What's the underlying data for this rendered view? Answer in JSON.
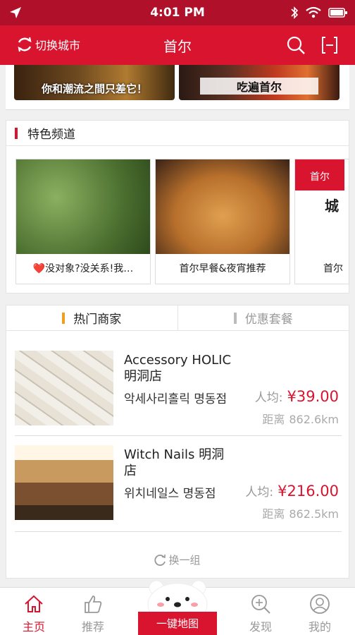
{
  "status": {
    "time": "4:01 PM",
    "icons": [
      "location-arrow-icon",
      "bluetooth-icon",
      "wifi-icon",
      "battery-icon"
    ]
  },
  "nav": {
    "switch_city_label": "切换城市",
    "title": "首尔",
    "search_icon": "search-icon",
    "scan_icon": "scan-icon"
  },
  "banner": {
    "left_text": "你和潮流之間只差它！",
    "right_text": "吃遍首尔"
  },
  "channels": {
    "title": "特色频道",
    "items": [
      {
        "caption": "❤️没对象?没关系!我…"
      },
      {
        "caption": "首尔早餐&夜宵推荐"
      },
      {
        "caption": "首尔",
        "tag": "首尔",
        "big": "城"
      }
    ]
  },
  "merchants": {
    "tabs": [
      {
        "label": "热门商家"
      },
      {
        "label": "优惠套餐"
      }
    ],
    "items": [
      {
        "name": "Accessory HOLIC 明洞店",
        "korean": "악세사리홀릭 명동점",
        "price_label": "人均:",
        "price_value": "¥39.00",
        "distance_label": "距离",
        "distance_value": "862.6km"
      },
      {
        "name": "Witch Nails 明洞店",
        "korean": "위치네일스 명동점",
        "price_label": "人均:",
        "price_value": "¥216.00",
        "distance_label": "距离",
        "distance_value": "862.5km"
      }
    ],
    "refresh_label": "换一组"
  },
  "tabbar": {
    "items": [
      {
        "label": "主页",
        "icon": "home-icon"
      },
      {
        "label": "推荐",
        "icon": "thumbs-up-icon"
      },
      {
        "label": "一键地图",
        "icon": "bear-mascot-icon"
      },
      {
        "label": "发现",
        "icon": "discover-search-icon"
      },
      {
        "label": "我的",
        "icon": "user-icon"
      }
    ]
  },
  "colors": {
    "accent": "#d8142f",
    "status_bar": "#b0102a",
    "tab_marker": "#f0a020"
  }
}
